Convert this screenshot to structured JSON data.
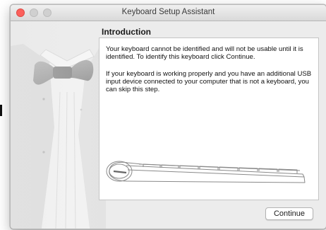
{
  "window": {
    "title": "Keyboard Setup Assistant"
  },
  "page": {
    "heading": "Introduction",
    "paragraphs": [
      "Your keyboard cannot be identified and will not be usable until it is identified. To identify this keyboard click Continue.",
      "If your keyboard is working properly and you have an additional USB input device connected to your computer that is not a keyboard, you can skip this step."
    ]
  },
  "buttons": {
    "continue_label": "Continue"
  },
  "colors": {
    "close_button": "#fc605c",
    "inactive_button": "#d0d0d0",
    "window_background": "#ececec"
  },
  "icons": {
    "illustration": "tuxedo-bowtie-icon",
    "keyboard": "keyboard-outline-icon"
  }
}
